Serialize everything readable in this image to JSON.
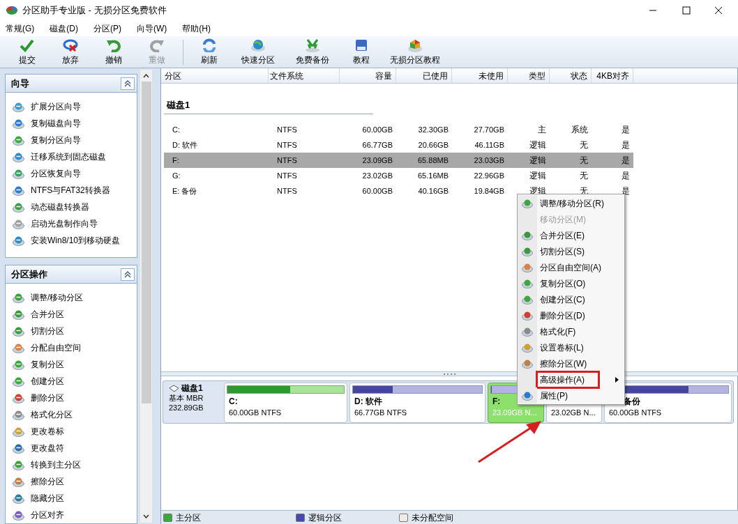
{
  "window": {
    "title": "分区助手专业版 - 无损分区免费软件"
  },
  "menu_bar": [
    "常规(G)",
    "磁盘(D)",
    "分区(P)",
    "向导(W)",
    "帮助(H)"
  ],
  "toolbar": [
    {
      "label": "提交",
      "disabled": false
    },
    {
      "label": "放弃",
      "disabled": false
    },
    {
      "label": "撤销",
      "disabled": false
    },
    {
      "label": "重做",
      "disabled": true
    },
    {
      "label": "刷新",
      "disabled": false
    },
    {
      "label": "快速分区",
      "disabled": false
    },
    {
      "label": "免费备份",
      "disabled": false
    },
    {
      "label": "教程",
      "disabled": false
    },
    {
      "label": "无损分区教程",
      "disabled": false
    }
  ],
  "sidebar": {
    "panels": [
      {
        "title": "向导",
        "items": [
          "扩展分区向导",
          "复制磁盘向导",
          "复制分区向导",
          "迁移系统到固态磁盘",
          "分区恢复向导",
          "NTFS与FAT32转换器",
          "动态磁盘转换器",
          "启动光盘制作向导",
          "安装Win8/10到移动硬盘"
        ]
      },
      {
        "title": "分区操作",
        "items": [
          "调整/移动分区",
          "合并分区",
          "切割分区",
          "分配自由空间",
          "复制分区",
          "创建分区",
          "删除分区",
          "格式化分区",
          "更改卷标",
          "更改盘符",
          "转换到主分区",
          "擦除分区",
          "隐藏分区",
          "分区对齐"
        ]
      }
    ]
  },
  "table": {
    "columns": [
      "分区",
      "文件系统",
      "容量",
      "已使用",
      "未使用",
      "类型",
      "状态",
      "4KB对齐"
    ],
    "group": "磁盘1",
    "rows": [
      {
        "cells": [
          "C:",
          "NTFS",
          "60.00GB",
          "32.30GB",
          "27.70GB",
          "主",
          "系统",
          "是"
        ],
        "selected": false
      },
      {
        "cells": [
          "D: 软件",
          "NTFS",
          "66.77GB",
          "20.66GB",
          "46.11GB",
          "逻辑",
          "无",
          "是"
        ],
        "selected": false
      },
      {
        "cells": [
          "F:",
          "NTFS",
          "23.09GB",
          "65.88MB",
          "23.03GB",
          "逻辑",
          "无",
          "是"
        ],
        "selected": true
      },
      {
        "cells": [
          "G:",
          "NTFS",
          "23.02GB",
          "65.16MB",
          "22.96GB",
          "逻辑",
          "无",
          "是"
        ],
        "selected": false
      },
      {
        "cells": [
          "E: 备份",
          "NTFS",
          "60.00GB",
          "40.16GB",
          "19.84GB",
          "逻辑",
          "无",
          "是"
        ],
        "selected": false
      }
    ]
  },
  "disk_map": {
    "disk": {
      "name": "磁盘1",
      "type": "基本 MBR",
      "size": "232.89GB"
    },
    "partitions": [
      {
        "label": "C:",
        "info": "60.00GB NTFS",
        "kind": "primary",
        "level": 0.54,
        "selected": false
      },
      {
        "label": "D: 软件",
        "info": "66.77GB NTFS",
        "kind": "logical",
        "level": 0.31,
        "selected": false
      },
      {
        "label": "F:",
        "info": "23.09GB N...",
        "kind": "logical",
        "level": 0.01,
        "selected": true
      },
      {
        "info": "23.02GB N...",
        "kind": "logical",
        "selected": false
      },
      {
        "label": "备份",
        "info": "60.00GB NTFS",
        "kind": "logical",
        "level": 0.67,
        "selected": false
      }
    ]
  },
  "context_menu": {
    "items": [
      {
        "label": "调整/移动分区(R)",
        "disabled": false,
        "submenu": false,
        "annotated": false
      },
      {
        "label": "移动分区(M)",
        "disabled": true,
        "submenu": false,
        "annotated": false
      },
      {
        "label": "合并分区(E)",
        "disabled": false,
        "submenu": false,
        "annotated": false
      },
      {
        "label": "切割分区(S)",
        "disabled": false,
        "submenu": false,
        "annotated": false
      },
      {
        "label": "分区自由空间(A)",
        "disabled": false,
        "submenu": false,
        "annotated": false
      },
      {
        "label": "复制分区(O)",
        "disabled": false,
        "submenu": false,
        "annotated": false
      },
      {
        "label": "创建分区(C)",
        "disabled": false,
        "submenu": false,
        "annotated": false
      },
      {
        "label": "删除分区(D)",
        "disabled": false,
        "submenu": false,
        "annotated": false
      },
      {
        "label": "格式化(F)",
        "disabled": false,
        "submenu": false,
        "annotated": false
      },
      {
        "label": "设置卷标(L)",
        "disabled": false,
        "submenu": false,
        "annotated": false
      },
      {
        "label": "擦除分区(W)",
        "disabled": false,
        "submenu": false,
        "annotated": false
      },
      {
        "label": "高级操作(A)",
        "disabled": false,
        "submenu": true,
        "annotated": true
      },
      {
        "label": "属性(P)",
        "disabled": false,
        "submenu": false,
        "annotated": false
      }
    ]
  },
  "status_bar": {
    "legend": [
      {
        "label": "主分区",
        "color": "#3aa83a"
      },
      {
        "label": "逻辑分区",
        "color": "#4848b0"
      },
      {
        "label": "未分配空间",
        "color": "#f0ece4"
      }
    ]
  }
}
